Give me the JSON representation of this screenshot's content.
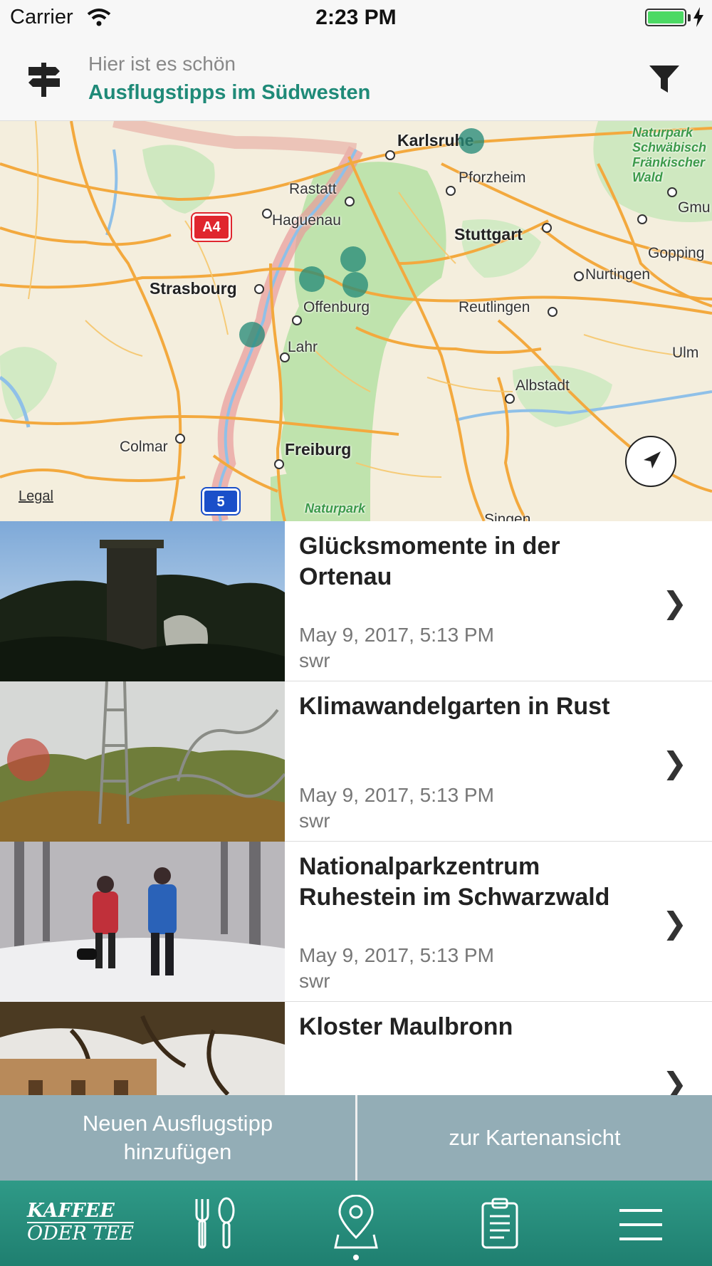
{
  "status_bar": {
    "carrier": "Carrier",
    "time": "2:23 PM"
  },
  "header": {
    "subtitle": "Hier ist es schön",
    "title": "Ausflugstipps im Südwesten",
    "left_icon": "signpost-icon",
    "right_icon": "filter-icon"
  },
  "map": {
    "legal": "Legal",
    "places": [
      "Karlsruhe",
      "Pforzheim",
      "Rastatt",
      "Haguenau",
      "Stuttgart",
      "Strasbourg",
      "Offenburg",
      "Reutlingen",
      "Nurtingen",
      "Gopping",
      "Lahr",
      "Ulm",
      "Albstadt",
      "Colmar",
      "Freiburg",
      "Gmu",
      "Singen"
    ],
    "parks": [
      "Naturpark Schwäbisch Fränkischer Wald",
      "Naturpark"
    ],
    "shields": [
      "A4",
      "5"
    ]
  },
  "list": {
    "items": [
      {
        "title": "Glücksmomente in der Ortenau",
        "date": "May 9, 2017, 5:13 PM",
        "source": "swr"
      },
      {
        "title": "Klimawandelgarten in Rust",
        "date": "May 9, 2017, 5:13 PM",
        "source": "swr"
      },
      {
        "title": "Nationalparkzentrum Ruhestein im Schwarzwald",
        "date": "May 9, 2017, 5:13 PM",
        "source": "swr"
      },
      {
        "title": "Kloster Maulbronn",
        "date": "",
        "source": ""
      }
    ]
  },
  "actions": {
    "add_tip": "Neuen Ausflugstipp hinzufügen",
    "map_view": "zur Kartenansicht"
  },
  "tabbar": {
    "logo_line1": "KAFFEE",
    "logo_line2": "ODER TEE",
    "icons": [
      "fork-spoon-icon",
      "location-pin-icon",
      "clipboard-icon",
      "menu-icon"
    ],
    "active_tab": "location-pin-icon"
  },
  "colors": {
    "accent": "#1f8a78",
    "tabbar": "#2a9482",
    "action_bar": "#93adb6",
    "marker": "#288c78"
  }
}
